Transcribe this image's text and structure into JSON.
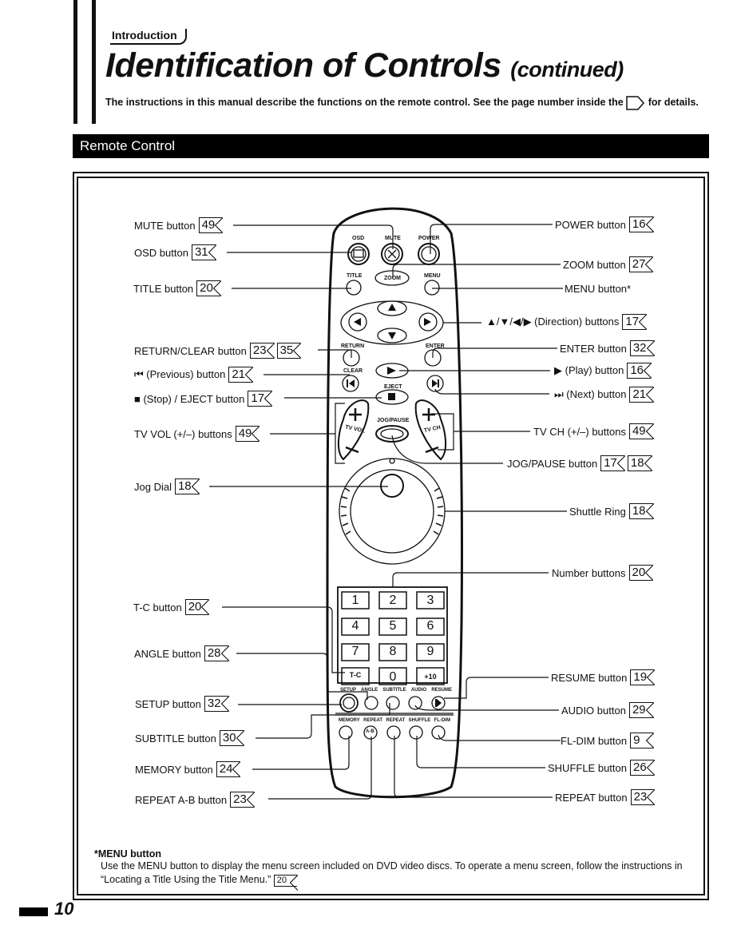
{
  "header": {
    "section": "Introduction",
    "title": "Identification of Controls",
    "title_suffix": "(continued)",
    "intro_before": "The instructions in this manual describe the functions on the remote control. See the page number inside the",
    "intro_after": "for details."
  },
  "banner": "Remote Control",
  "left_labels": [
    {
      "label": "MUTE button",
      "pages": [
        "49"
      ]
    },
    {
      "label": "OSD button",
      "pages": [
        "31"
      ]
    },
    {
      "label": "TITLE button",
      "pages": [
        "20"
      ]
    },
    {
      "label": "RETURN/CLEAR button",
      "pages": [
        "23",
        "35"
      ]
    },
    {
      "label": "⏮ (Previous) button",
      "pages": [
        "21"
      ]
    },
    {
      "label": "■ (Stop) / EJECT button",
      "pages": [
        "17"
      ]
    },
    {
      "label": "TV VOL (+/–) buttons",
      "pages": [
        "49"
      ]
    },
    {
      "label": "Jog Dial",
      "pages": [
        "18"
      ]
    },
    {
      "label": "T-C button",
      "pages": [
        "20"
      ]
    },
    {
      "label": "ANGLE button",
      "pages": [
        "28"
      ]
    },
    {
      "label": "SETUP button",
      "pages": [
        "32"
      ]
    },
    {
      "label": "SUBTITLE button",
      "pages": [
        "30"
      ]
    },
    {
      "label": "MEMORY button",
      "pages": [
        "24"
      ]
    },
    {
      "label": "REPEAT A-B button",
      "pages": [
        "23"
      ]
    }
  ],
  "right_labels": [
    {
      "label": "POWER button",
      "pages": [
        "16"
      ]
    },
    {
      "label": "ZOOM button",
      "pages": [
        "27"
      ]
    },
    {
      "label": "MENU button*",
      "pages": []
    },
    {
      "label": "▲/▼/◀/▶ (Direction) buttons",
      "pages": [
        "17"
      ]
    },
    {
      "label": "ENTER button",
      "pages": [
        "32"
      ]
    },
    {
      "label": "▶ (Play) button",
      "pages": [
        "16"
      ]
    },
    {
      "label": "⏭ (Next) button",
      "pages": [
        "21"
      ]
    },
    {
      "label": "TV CH (+/–) buttons",
      "pages": [
        "49"
      ]
    },
    {
      "label": "JOG/PAUSE button",
      "pages": [
        "17",
        "18"
      ]
    },
    {
      "label": "Shuttle Ring",
      "pages": [
        "18"
      ]
    },
    {
      "label": "Number buttons",
      "pages": [
        "20"
      ]
    },
    {
      "label": "RESUME button",
      "pages": [
        "19"
      ]
    },
    {
      "label": "AUDIO button",
      "pages": [
        "29"
      ]
    },
    {
      "label": "FL-DIM button",
      "pages": [
        "9"
      ]
    },
    {
      "label": "SHUFFLE button",
      "pages": [
        "26"
      ]
    },
    {
      "label": "REPEAT button",
      "pages": [
        "23"
      ]
    }
  ],
  "remote": {
    "top_labels": [
      "OSD",
      "MUTE",
      "POWER"
    ],
    "title_label": "TITLE",
    "zoom_label": "ZOOM",
    "menu_label": "MENU",
    "return_label": "RETURN",
    "enter_label": "ENTER",
    "clear_label": "CLEAR",
    "eject_label": "EJECT",
    "jog_pause_label": "JOG/PAUSE",
    "tv_vol_label": "TV VOL",
    "tv_ch_label": "TV CH",
    "keypad": [
      "1",
      "2",
      "3",
      "4",
      "5",
      "6",
      "7",
      "8",
      "9",
      "T-C",
      "0",
      "+10"
    ],
    "row1_labels": [
      "SETUP",
      "ANGLE",
      "SUBTITLE",
      "AUDIO",
      "RESUME"
    ],
    "row2_labels": [
      "MEMORY",
      "REPEAT",
      "REPEAT",
      "SHUFFLE",
      "FL-DIM"
    ],
    "ab_label": "A-B"
  },
  "note": {
    "title": "*MENU button",
    "text": "Use the MENU button to display the menu screen included on DVD video discs. To operate a menu screen, follow the instructions in “Locating a Title Using the Title Menu.”",
    "page": "20"
  },
  "page_number": "10"
}
